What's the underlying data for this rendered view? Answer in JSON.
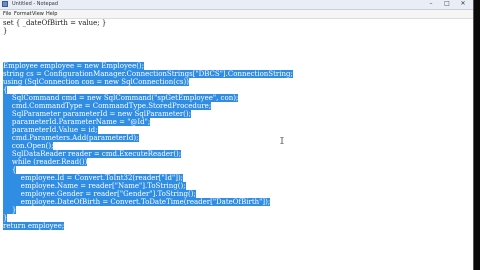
{
  "window": {
    "title": "Untitled - Notepad",
    "minimize_label": "–",
    "maximize_label": "□",
    "close_label": "✕"
  },
  "menu": [
    "File",
    "Format",
    "View",
    "Help"
  ],
  "editor": {
    "lines": [
      {
        "text": "set { _dateOfBirth = value; }",
        "selected": false
      },
      {
        "text": "}",
        "selected": false
      },
      {
        "text": "Employee employee = new Employee();",
        "selected": true
      },
      {
        "text": "string cs = ConfigurationManager.ConnectionStrings[\"DBCS\"].ConnectionString;",
        "selected": true
      },
      {
        "text": "using (SqlConnection con = new SqlConnection(cs))",
        "selected": true
      },
      {
        "text": "{",
        "selected": true
      },
      {
        "text": "    SqlCommand cmd = new SqlCommand(\"spGetEmployee\", con);",
        "selected": true
      },
      {
        "text": "    cmd.CommandType = CommandType.StoredProcedure;",
        "selected": true
      },
      {
        "text": "    SqlParameter parameterId = new SqlParameter();",
        "selected": true
      },
      {
        "text": "    parameterId.ParameterName = \"@Id\";",
        "selected": true
      },
      {
        "text": "    parameterId.Value = id;",
        "selected": true
      },
      {
        "text": "    cmd.Parameters.Add(parameterId);",
        "selected": true
      },
      {
        "text": "    con.Open();",
        "selected": true
      },
      {
        "text": "    SqlDataReader reader = cmd.ExecuteReader();",
        "selected": true
      },
      {
        "text": "    while (reader.Read())",
        "selected": true
      },
      {
        "text": "    {",
        "selected": true
      },
      {
        "text": "        employee.Id = Convert.ToInt32(reader[\"Id\"]);",
        "selected": true
      },
      {
        "text": "        employee.Name = reader[\"Name\"].ToString();",
        "selected": true
      },
      {
        "text": "        employee.Gender = reader[\"Gender\"].ToString();",
        "selected": true
      },
      {
        "text": "        employee.DateOfBirth = Convert.ToDateTime(reader[\"DateOfBirth\"]);",
        "selected": true
      },
      {
        "text": "    }",
        "selected": true
      },
      {
        "text": "}",
        "selected": true
      },
      {
        "text": "return employee;",
        "selected": true
      }
    ]
  },
  "colors": {
    "selection": "#2f8de4",
    "selection_text": "#ffffff"
  }
}
